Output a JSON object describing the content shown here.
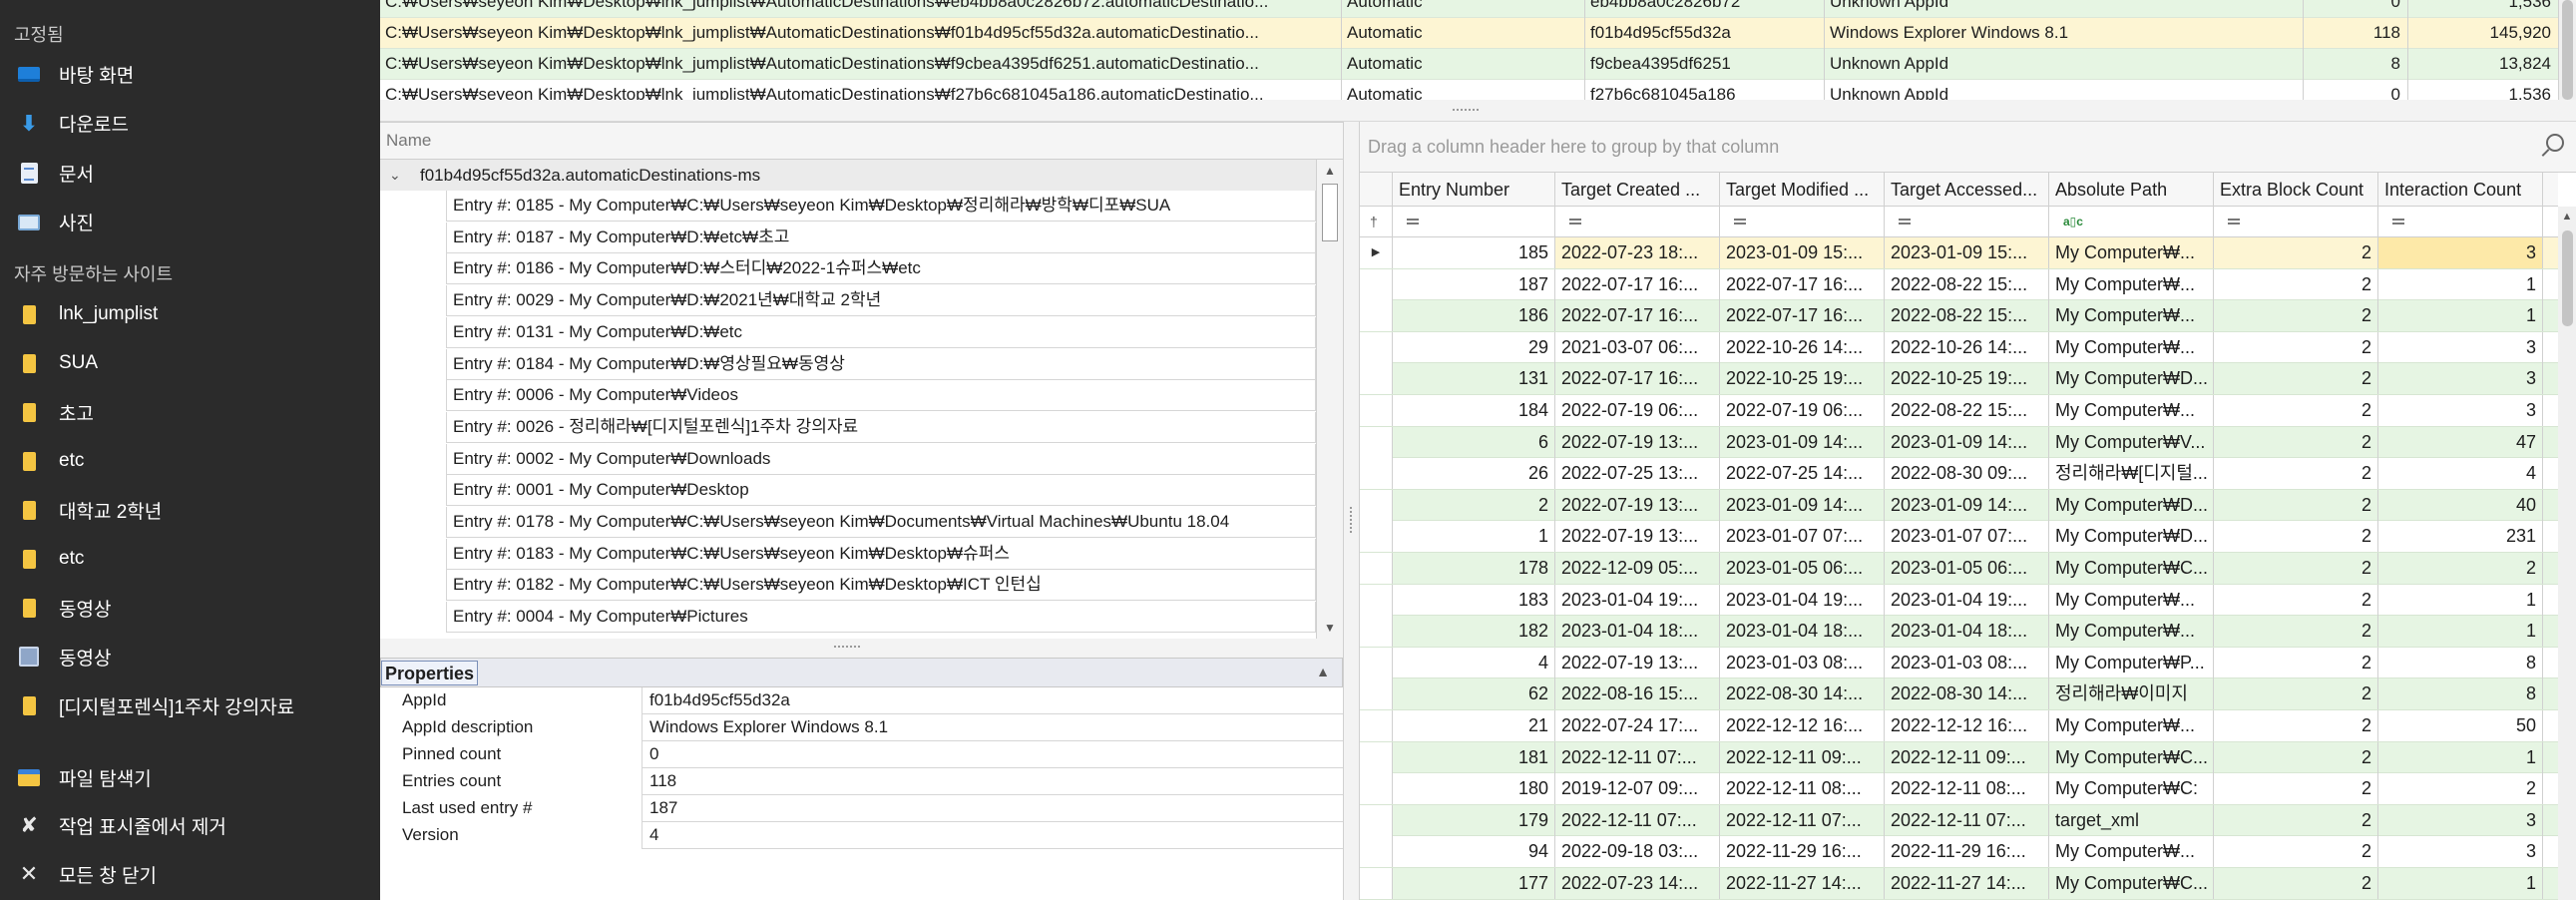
{
  "jumplist": {
    "pinned_header": "고정됨",
    "pinned": [
      {
        "label": "바탕 화면",
        "icon": "desktop-icon"
      },
      {
        "label": "다운로드",
        "icon": "download-icon"
      },
      {
        "label": "문서",
        "icon": "document-icon"
      },
      {
        "label": "사진",
        "icon": "picture-icon"
      }
    ],
    "frequent_header": "자주 방문하는 사이트",
    "frequent": [
      {
        "label": "lnk_jumplist",
        "icon": "folder-icon"
      },
      {
        "label": "SUA",
        "icon": "folder-icon"
      },
      {
        "label": "초고",
        "icon": "folder-icon"
      },
      {
        "label": "etc",
        "icon": "folder-icon"
      },
      {
        "label": "대학교 2학년",
        "icon": "folder-icon"
      },
      {
        "label": "etc",
        "icon": "folder-icon"
      },
      {
        "label": "동영상",
        "icon": "folder-icon"
      },
      {
        "label": "동영상",
        "icon": "video-icon"
      },
      {
        "label": "[디지털포렌식]1주차 강의자료",
        "icon": "folder-icon"
      }
    ],
    "actions": [
      {
        "label": "파일 탐색기",
        "icon": "file-explorer-icon"
      },
      {
        "label": "작업 표시줄에서 제거",
        "icon": "unpin-icon"
      },
      {
        "label": "모든 창 닫기",
        "icon": "close-icon"
      }
    ]
  },
  "top_grid": {
    "rows": [
      {
        "path": "C:₩Users₩seyeon Kim₩Desktop₩lnk_jumplist₩AutomaticDestinations₩eb4bb8a0c2826b72.automaticDestinatio...",
        "type": "Automatic",
        "appid": "eb4bb8a0c2826b72",
        "desc": "Unknown AppId",
        "entries": "0",
        "size": "1,536",
        "highlight": false
      },
      {
        "path": "C:₩Users₩seyeon Kim₩Desktop₩lnk_jumplist₩AutomaticDestinations₩f01b4d95cf55d32a.automaticDestinatio...",
        "type": "Automatic",
        "appid": "f01b4d95cf55d32a",
        "desc": "Windows Explorer Windows 8.1",
        "entries": "118",
        "size": "145,920",
        "highlight": true
      },
      {
        "path": "C:₩Users₩seyeon Kim₩Desktop₩lnk_jumplist₩AutomaticDestinations₩f9cbea4395df6251.automaticDestinatio...",
        "type": "Automatic",
        "appid": "f9cbea4395df6251",
        "desc": "Unknown AppId",
        "entries": "8",
        "size": "13,824",
        "highlight": false
      },
      {
        "path": "C:₩Users₩seyeon Kim₩Desktop₩lnk_jumplist₩AutomaticDestinations₩f27b6c681045a186.automaticDestinatio...",
        "type": "Automatic",
        "appid": "f27b6c681045a186",
        "desc": "Unknown AppId",
        "entries": "0",
        "size": "1,536",
        "highlight": false
      }
    ]
  },
  "tree": {
    "header": "Name",
    "root": "f01b4d95cf55d32a.automaticDestinations-ms",
    "entries": [
      "Entry #: 0185 - My Computer₩C:₩Users₩seyeon Kim₩Desktop₩정리해라₩방학₩디포₩SUA",
      "Entry #: 0187 - My Computer₩D:₩etc₩초고",
      "Entry #: 0186 - My Computer₩D:₩스터디₩2022-1슈퍼스₩etc",
      "Entry #: 0029 - My Computer₩D:₩2021년₩대학교 2학년",
      "Entry #: 0131 - My Computer₩D:₩etc",
      "Entry #: 0184 - My Computer₩D:₩영상필요₩동영상",
      "Entry #: 0006 - My Computer₩Videos",
      "Entry #: 0026 - 정리해라₩[디지털포렌식]1주차 강의자료",
      "Entry #: 0002 - My Computer₩Downloads",
      "Entry #: 0001 - My Computer₩Desktop",
      "Entry #: 0178 - My Computer₩C:₩Users₩seyeon Kim₩Documents₩Virtual Machines₩Ubuntu 18.04",
      "Entry #: 0183 - My Computer₩C:₩Users₩seyeon Kim₩Desktop₩슈퍼스",
      "Entry #: 0182 - My Computer₩C:₩Users₩seyeon Kim₩Desktop₩ICT 인턴십",
      "Entry #: 0004 - My Computer₩Pictures"
    ]
  },
  "properties": {
    "title": "Properties",
    "rows": [
      {
        "key": "AppId",
        "value": "f01b4d95cf55d32a"
      },
      {
        "key": "AppId description",
        "value": "Windows Explorer Windows 8.1"
      },
      {
        "key": "Pinned count",
        "value": "0"
      },
      {
        "key": "Entries count",
        "value": "118"
      },
      {
        "key": "Last used entry #",
        "value": "187"
      },
      {
        "key": "Version",
        "value": "4"
      }
    ]
  },
  "entries_grid": {
    "group_hint": "Drag a column header here to group by that column",
    "columns": [
      "Entry Number",
      "Target Created ...",
      "Target Modified ...",
      "Target Accessed...",
      "Absolute Path",
      "Extra Block Count",
      "Interaction Count"
    ],
    "filter_text_symbol": "a▯c",
    "rows": [
      [
        "185",
        "2022-07-23 18:...",
        "2023-01-09 15:...",
        "2023-01-09 15:...",
        "My Computer₩...",
        "2",
        "3"
      ],
      [
        "187",
        "2022-07-17 16:...",
        "2022-07-17 16:...",
        "2022-08-22 15:...",
        "My Computer₩...",
        "2",
        "1"
      ],
      [
        "186",
        "2022-07-17 16:...",
        "2022-07-17 16:...",
        "2022-08-22 15:...",
        "My Computer₩...",
        "2",
        "1"
      ],
      [
        "29",
        "2021-03-07 06:...",
        "2022-10-26 14:...",
        "2022-10-26 14:...",
        "My Computer₩...",
        "2",
        "3"
      ],
      [
        "131",
        "2022-07-17 16:...",
        "2022-10-25 19:...",
        "2022-10-25 19:...",
        "My Computer₩D...",
        "2",
        "3"
      ],
      [
        "184",
        "2022-07-19 06:...",
        "2022-07-19 06:...",
        "2022-08-22 15:...",
        "My Computer₩...",
        "2",
        "3"
      ],
      [
        "6",
        "2022-07-19 13:...",
        "2023-01-09 14:...",
        "2023-01-09 14:...",
        "My Computer₩V...",
        "2",
        "47"
      ],
      [
        "26",
        "2022-07-25 13:...",
        "2022-07-25 14:...",
        "2022-08-30 09:...",
        "정리해라₩[디지털...",
        "2",
        "4"
      ],
      [
        "2",
        "2022-07-19 13:...",
        "2023-01-09 14:...",
        "2023-01-09 14:...",
        "My Computer₩D...",
        "2",
        "40"
      ],
      [
        "1",
        "2022-07-19 13:...",
        "2023-01-07 07:...",
        "2023-01-07 07:...",
        "My Computer₩D...",
        "2",
        "231"
      ],
      [
        "178",
        "2022-12-09 05:...",
        "2023-01-05 06:...",
        "2023-01-05 06:...",
        "My Computer₩C...",
        "2",
        "2"
      ],
      [
        "183",
        "2023-01-04 19:...",
        "2023-01-04 19:...",
        "2023-01-04 19:...",
        "My Computer₩...",
        "2",
        "1"
      ],
      [
        "182",
        "2023-01-04 18:...",
        "2023-01-04 18:...",
        "2023-01-04 18:...",
        "My Computer₩...",
        "2",
        "1"
      ],
      [
        "4",
        "2022-07-19 13:...",
        "2023-01-03 08:...",
        "2023-01-03 08:...",
        "My Computer₩P...",
        "2",
        "8"
      ],
      [
        "62",
        "2022-08-16 15:...",
        "2022-08-30 14:...",
        "2022-08-30 14:...",
        "정리해라₩이미지",
        "2",
        "8"
      ],
      [
        "21",
        "2022-07-24 17:...",
        "2022-12-12 16:...",
        "2022-12-12 16:...",
        "My Computer₩...",
        "2",
        "50"
      ],
      [
        "181",
        "2022-12-11 07:...",
        "2022-12-11 09:...",
        "2022-12-11 09:...",
        "My Computer₩C...",
        "2",
        "1"
      ],
      [
        "180",
        "2019-12-07 09:...",
        "2022-12-11 08:...",
        "2022-12-11 08:...",
        "My Computer₩C:",
        "2",
        "2"
      ],
      [
        "179",
        "2022-12-11 07:...",
        "2022-12-11 07:...",
        "2022-12-11 07:...",
        "target_xml",
        "2",
        "3"
      ],
      [
        "94",
        "2022-09-18 03:...",
        "2022-11-29 16:...",
        "2022-11-29 16:...",
        "My Computer₩...",
        "2",
        "3"
      ],
      [
        "177",
        "2022-07-23 14:...",
        "2022-11-27 14:...",
        "2022-11-27 14:...",
        "My Computer₩C...",
        "2",
        "1"
      ]
    ]
  },
  "colors": {
    "jumplist_bg": "#2b2b2b",
    "row_alt_green": "#e6f5e3",
    "row_selected_yellow": "#fdf5d3",
    "selected_cell": "#fde9a8"
  }
}
